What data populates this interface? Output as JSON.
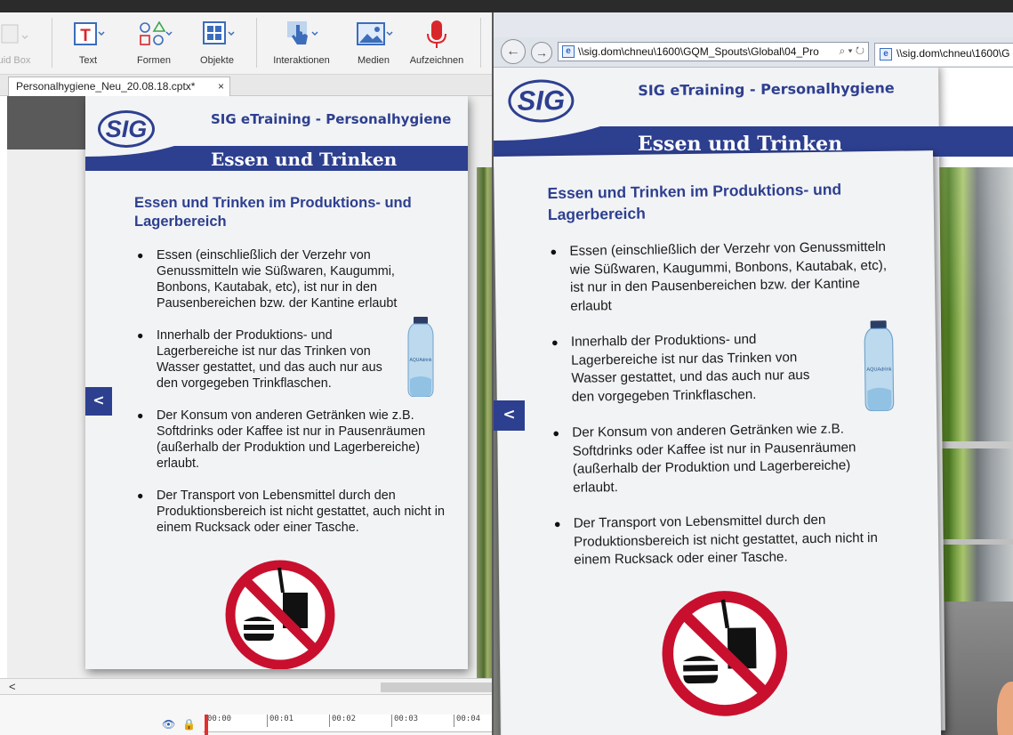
{
  "ribbon": {
    "items": [
      {
        "label": "uid Box",
        "icon": "quiz-box-icon",
        "disabled": true
      },
      {
        "label": "Text",
        "icon": "text-icon"
      },
      {
        "label": "Formen",
        "icon": "shapes-icon"
      },
      {
        "label": "Objekte",
        "icon": "objects-icon"
      },
      {
        "label": "Interaktionen",
        "icon": "hand-pointer-icon"
      },
      {
        "label": "Medien",
        "icon": "image-icon"
      },
      {
        "label": "Aufzeichnen",
        "icon": "microphone-icon"
      }
    ]
  },
  "editor": {
    "tab_label": "Personalhygiene_Neu_20.08.18.cptx*",
    "tab_close": "×",
    "scroll_left": "<",
    "timeline_ticks": [
      "00:00",
      "00:01",
      "00:02",
      "00:03",
      "00:04"
    ]
  },
  "slide": {
    "logo_text": "SIG",
    "app_title": "SIG eTraining - Personalhygiene",
    "section_title": "Essen und Trinken",
    "heading": "Essen und Trinken im Produktions- und Lagerbereich",
    "bullets": [
      "Essen (einschließlich der Verzehr von Genussmitteln wie Süßwaren, Kaugummi, Bonbons, Kautabak, etc), ist nur in den Pausenbereichen bzw. der Kantine erlaubt",
      "Innerhalb der Produktions- und Lagerbereiche ist nur das Trinken von Wasser gestattet, und das auch nur aus den vorgegeben Trinkflaschen.",
      "Der Konsum von anderen Getränken wie z.B. Softdrinks oder Kaffee ist nur in Pausenräumen (außerhalb der Produktion und Lagerbereiche) erlaubt.",
      "Der Transport von Lebensmittel durch den Produktionsbereich ist nicht gestattet, auch nicht in einem Rucksack oder einer Tasche."
    ],
    "back_label": "<",
    "bottle_label": "AQUAdrink"
  },
  "browser": {
    "back": "←",
    "forward": "→",
    "address": "\\\\sig.dom\\chneu\\1600\\GQM_Spouts\\Global\\04_Pro",
    "address_tools": "⌕ ▾ ↻",
    "tab_label": "\\\\sig.dom\\chneu\\1600\\G",
    "favicon": "e"
  },
  "colors": {
    "brand_blue": "#2d3f8f",
    "prohibition_red": "#c8102e"
  }
}
